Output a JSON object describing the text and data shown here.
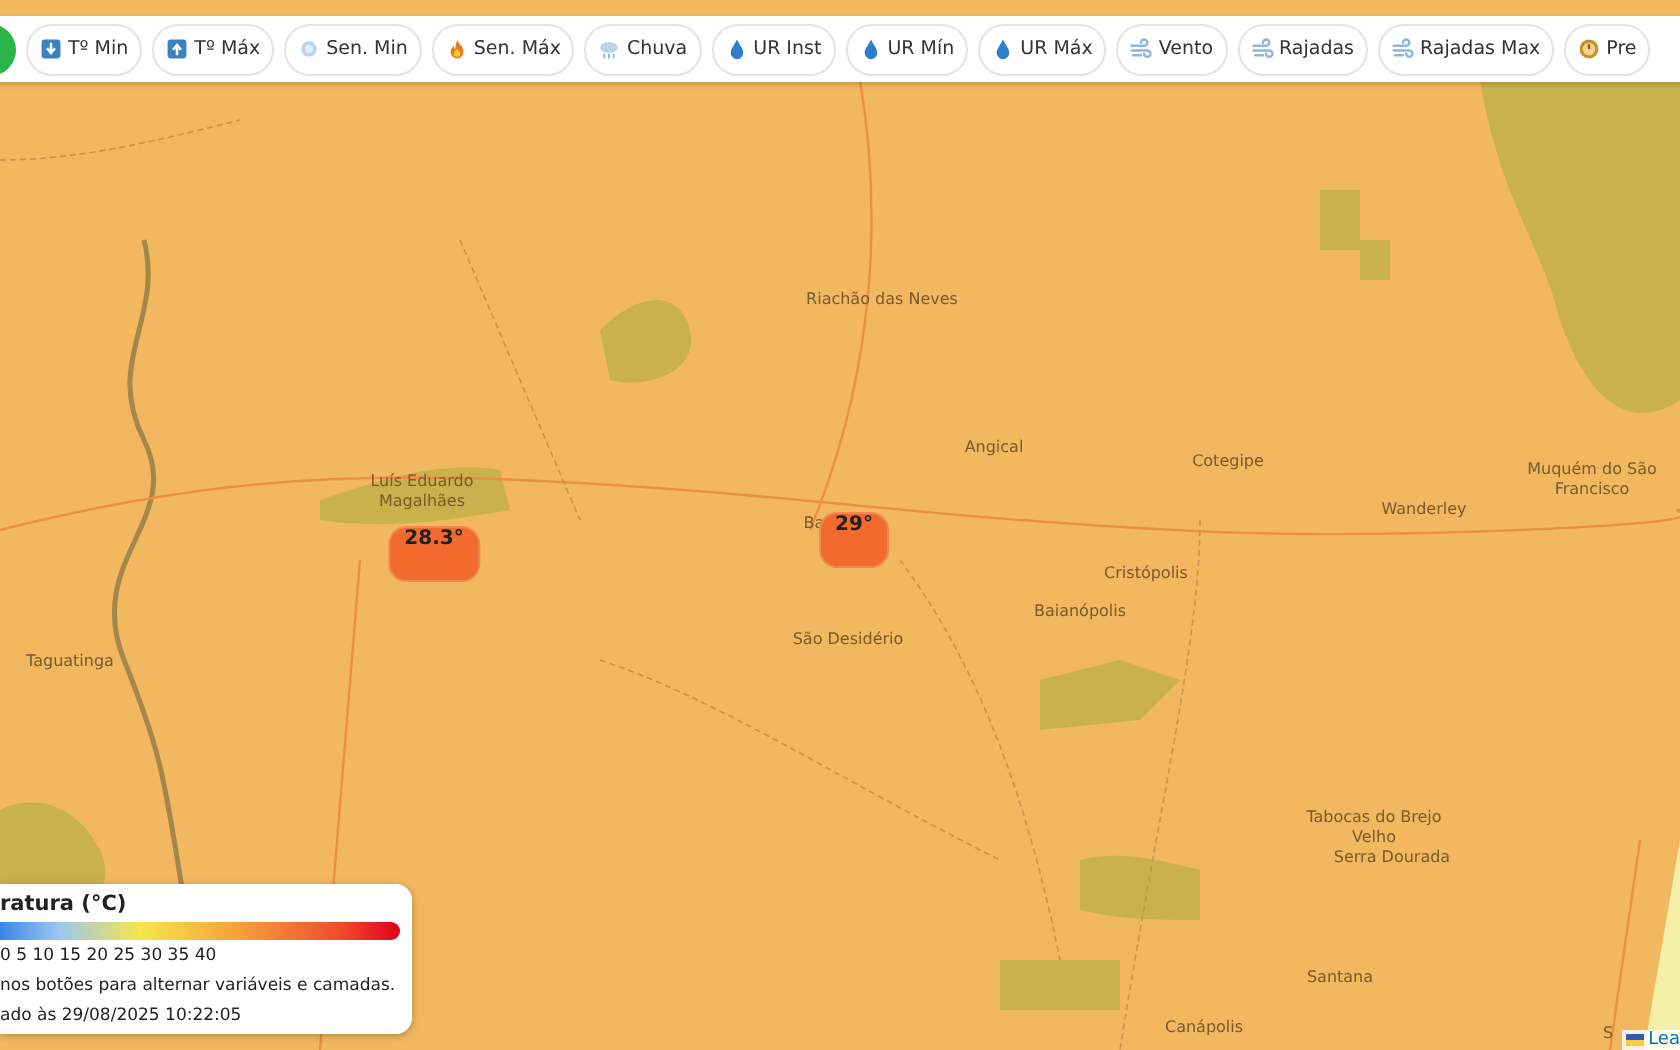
{
  "toolbar": {
    "buttons": [
      {
        "label": "Tº Min",
        "kind": "min"
      },
      {
        "label": "Tº Máx",
        "kind": "max"
      },
      {
        "label": "Sen. Min",
        "kind": "cold"
      },
      {
        "label": "Sen. Máx",
        "kind": "fire"
      },
      {
        "label": "Chuva",
        "kind": "rain"
      },
      {
        "label": "UR Inst",
        "kind": "drop"
      },
      {
        "label": "UR Mín",
        "kind": "drop"
      },
      {
        "label": "UR Máx",
        "kind": "drop"
      },
      {
        "label": "Vento",
        "kind": "wind"
      },
      {
        "label": "Rajadas",
        "kind": "wind"
      },
      {
        "label": "Rajadas Max",
        "kind": "wind"
      },
      {
        "label": "Pre",
        "kind": "gauge"
      }
    ]
  },
  "map": {
    "places": [
      "Riachão das Neves",
      "Luís Eduardo Magalhães",
      "Ba",
      "Angical",
      "Cotegipe",
      "Wanderley",
      "Muquém do São Francisco",
      "Cristópolis",
      "Baianópolis",
      "São Desidério",
      "Taguatinga",
      "Tabocas do Brejo Velho",
      "Serra Dourada",
      "Santana",
      "Canápolis",
      "S"
    ],
    "markers": [
      {
        "value": "28.3°"
      },
      {
        "value": "29°"
      }
    ],
    "attribution": "Lea"
  },
  "legend": {
    "title": "ratura (°C)",
    "scale": "0 5 10 15 20 25 30 35 40",
    "hint": "nos botões para alternar variáveis e camadas.",
    "updated": "ado às 29/08/2025 10:22:05"
  }
}
